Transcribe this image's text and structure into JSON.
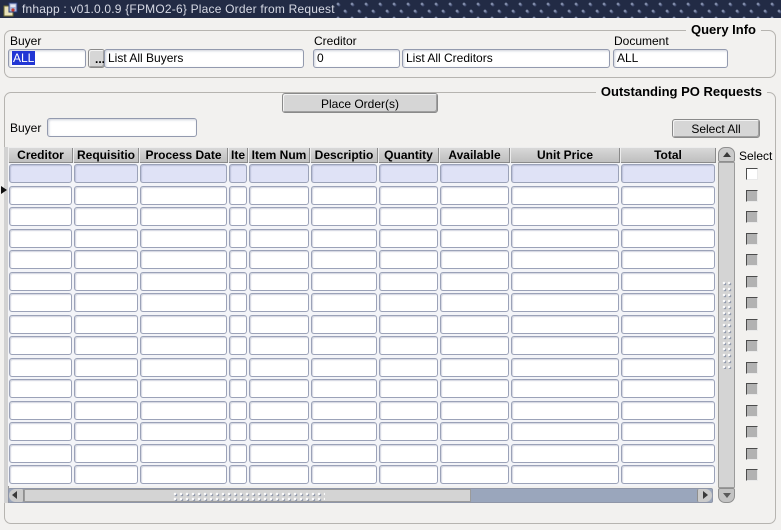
{
  "window": {
    "title": "fnhapp : v01.0.0.9 {FPMO2-6} Place Order from Request"
  },
  "query_info": {
    "frame_label": "Query Info",
    "buyer_label": "Buyer",
    "buyer_value": "ALL",
    "buyer_lov_button": "...",
    "buyer_list_value": "List All Buyers",
    "creditor_label": "Creditor",
    "creditor_value": "0",
    "creditor_list_value": "List All Creditors",
    "document_label": "Document",
    "document_value": "ALL"
  },
  "po_requests": {
    "frame_label": "Outstanding PO Requests",
    "place_order_button": "Place Order(s)",
    "buyer_label": "Buyer",
    "buyer_value": "",
    "select_all_button": "Select All",
    "select_column_label": "Select",
    "columns": [
      "Creditor",
      "Requisitio",
      "Process Date",
      "Ite",
      "Item Num",
      "Descriptio",
      "Quantity",
      "Available",
      "Unit Price",
      "Total"
    ],
    "visible_row_count": 15,
    "current_row_index": 0,
    "rows": []
  },
  "colors": {
    "titlebar_bg": "#222b45",
    "selection_bg": "#2136d4",
    "current_row_bg": "#dfe2f6",
    "table_header_bg": "#c9c9c9",
    "scrollbar_track": "#9aa6bc",
    "page_bg": "#f2f1ef"
  }
}
